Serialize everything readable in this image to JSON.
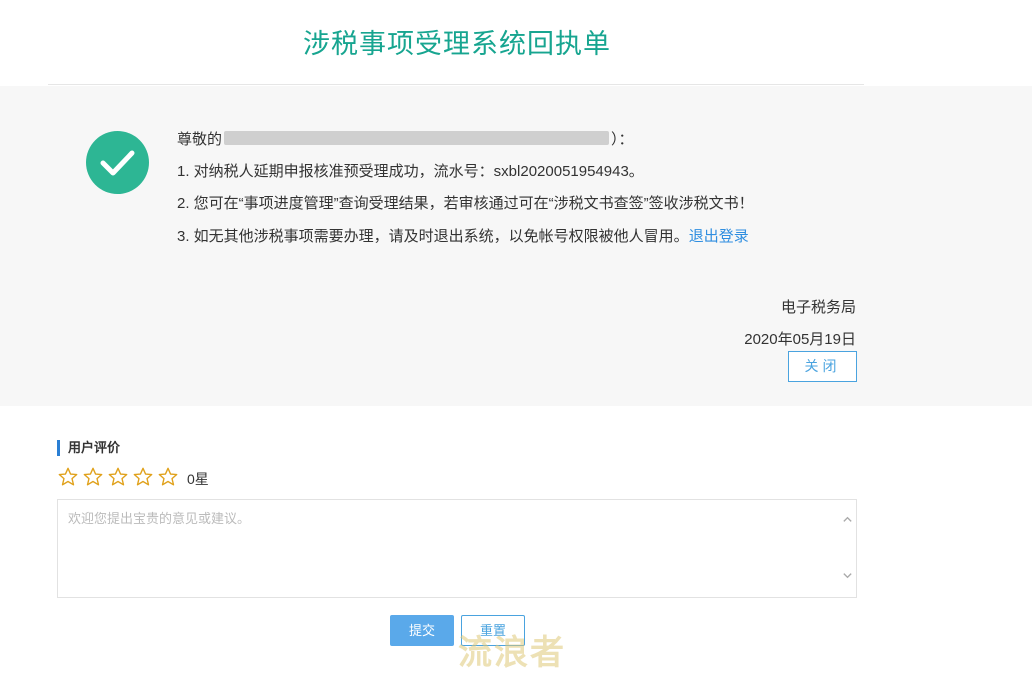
{
  "header": {
    "title": "涉税事项受理系统回执单"
  },
  "receipt": {
    "greeting_prefix": "尊敬的",
    "greeting_suffix": "）：",
    "line1": "1. 对纳税人延期申报核准预受理成功，流水号：sxbl2020051954943。",
    "line2": "2. 您可在“事项进度管理”查询受理结果，若审核通过可在“涉税文书查签”签收涉税文书！",
    "line3_text": "3. 如无其他涉税事项需要办理，请及时退出系统，以免帐号权限被他人冒用。",
    "line3_link": "退出登录",
    "issuer": "电子税务局",
    "date": "2020年05月19日",
    "close_label": "关闭",
    "icon": "check-circle-icon",
    "accent_color": "#2db694"
  },
  "feedback": {
    "section_title": "用户评价",
    "star_icon": "star-outline-icon",
    "rating": 0,
    "max_rating": 5,
    "rating_text": "0星",
    "placeholder": "欢迎您提出宝贵的意见或建议。",
    "submit_label": "提交",
    "reset_label": "重置"
  },
  "watermark": "流浪者"
}
